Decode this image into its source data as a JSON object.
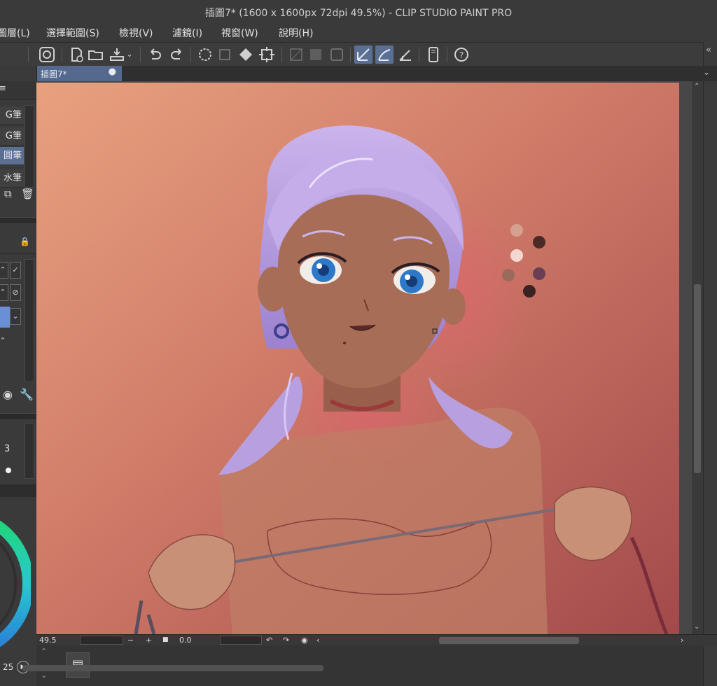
{
  "window": {
    "title": "插圖7* (1600 x 1600px 72dpi 49.5%)  - CLIP STUDIO PAINT PRO"
  },
  "menu": [
    "圖層(L)",
    "選擇範圍(S)",
    "檢視(V)",
    "濾鏡(I)",
    "視窗(W)",
    "說明(H)"
  ],
  "toolbar": {
    "icons": [
      "clip-studio-logo-icon",
      "new-file-icon",
      "open-folder-icon",
      "export-icon",
      "undo-icon",
      "redo-icon",
      "clear-selection-icon",
      "convert-icon",
      "fill-icon",
      "transform-icon",
      "hide-selection-icon",
      "selection-grey-icon",
      "selection-box-icon",
      "snap-ruler-icon",
      "snap-special-ruler-icon",
      "snap-grid-icon",
      "device-icon",
      "help-icon"
    ]
  },
  "document_tab": {
    "label": "插圖7*",
    "modified_dot": "●"
  },
  "sub_tool": {
    "items": [
      "G筆",
      "G筆",
      "圓筆",
      "水筆"
    ],
    "selected_index": 2
  },
  "tool_property": {
    "value": "3"
  },
  "status": {
    "zoom": "49.5",
    "minus": "−",
    "plus": "+",
    "angle": "0.0",
    "bottom_number": "25"
  },
  "canvas": {
    "palette_swatches": [
      "#d6a08e",
      "#4a2a26",
      "#f4d8d0",
      "#9a6a5c",
      "#6a3f55",
      "#3a2222"
    ]
  },
  "colors": {
    "accent": "#5b6f93",
    "panel": "#3a3a3a",
    "background_light": "#e49b82",
    "background_dark": "#a34c4b",
    "skin": "#a76a55",
    "hair": "#b49ad8"
  }
}
